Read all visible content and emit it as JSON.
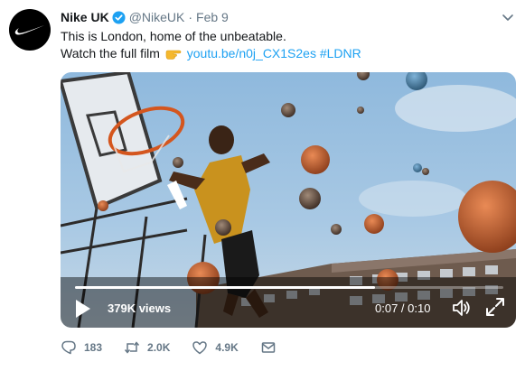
{
  "tweet": {
    "name": "Nike UK",
    "handle": "@NikeUK",
    "separator": "·",
    "date": "Feb 9",
    "line1": "This is London, home of the unbeatable.",
    "line2_prefix": "Watch the full film",
    "emoji_icon": "pointing-hand-emoji",
    "link": "youtu.be/n0j_CX1S2es",
    "hashtag": "#LDNR"
  },
  "video": {
    "views": "379K views",
    "time": "0:07 / 0:10",
    "progress": 0.7
  },
  "actions": {
    "replies": "183",
    "retweets": "2.0K",
    "likes": "4.9K"
  },
  "colors": {
    "accent": "#1da1f2",
    "muted": "#657786",
    "text": "#14171a"
  }
}
